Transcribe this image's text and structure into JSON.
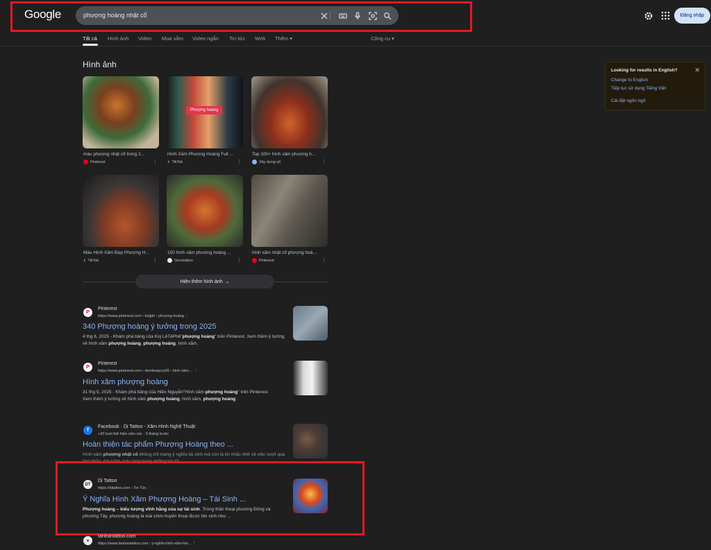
{
  "header": {
    "logo": "Google",
    "search_value": "phượng hoàng nhật cổ",
    "signin_label": "Đăng nhập"
  },
  "tabs": [
    {
      "label": "Tất cả"
    },
    {
      "label": "Hình ảnh"
    },
    {
      "label": "Video"
    },
    {
      "label": "Mua sắm"
    },
    {
      "label": "Video ngắn"
    },
    {
      "label": "Tin tức"
    },
    {
      "label": "Web"
    },
    {
      "label": "Thêm"
    }
  ],
  "tools_label": "Công cụ",
  "images": {
    "heading": "Hình ảnh",
    "badge": "Phượng hoàng",
    "more_label": "Hiện thêm hình ảnh",
    "items": [
      {
        "caption": "mẫu phượng nhật cổ trong 2...",
        "source": "Pinterest"
      },
      {
        "caption": "Hình Xăm Phượng Hoàng Full ...",
        "source": "TikTok"
      },
      {
        "caption": "Top 100+ hình xăm phượng h...",
        "source": "Xây dựng số"
      },
      {
        "caption": "Mẫu Hình Xăm Đẹp Phượng H...",
        "source": "TikTok"
      },
      {
        "caption": "150 hình xăm phượng hoàng ...",
        "source": "Genztattoo"
      },
      {
        "caption": "hình xăm nhật cổ phượng hoà...",
        "source": "Pinterest"
      }
    ]
  },
  "results": [
    {
      "site": "Pinterest",
      "url": "https://www.pinterest.com › kojtph › phượng-hoàng",
      "title": "340 Phượng hoàng ý tưởng trong 2025",
      "snippet_html": "4 thg 6, 2025 - Khám phá bảng của Koj LêTêPhê\"<b>phượng hoàng</b>\" trên Pinterest. Xem thêm ý tưởng về hình xăm <b>phượng hoàng</b>, <b>phượng hoàng</b>, hình xăm."
    },
    {
      "site": "Pinterest",
      "url": "https://www.pinterest.com › devilmaycry09 › hình-xăm-...",
      "title": "Hình xăm phượng hoàng",
      "snippet_html": "31 thg 5, 2025 - Khám phá bảng của Hiền Nguyễn\"Hình xăm <b>phượng hoàng</b>\" trên Pinterest. Xem thêm ý tưởng về hình xăm <b>phượng hoàng</b>, hình xăm, <b>phượng hoàng</b>."
    },
    {
      "site": "Facebook · Dị Tattoo - Xăm Hình Nghệ Thuật",
      "url": "+20 lượt thể hiện cảm xúc · 9 tháng trước",
      "title": "Hoàn thiện tác phẩm Phượng Hoàng theo ...",
      "snippet_html": "Hình xăm <b>phượng nhật cổ</b> không chỉ mang ý nghĩa tái sinh mà còn là lời nhắc nhở về việc vượt qua khó khăn, tìm kiếm ánh sáng trong những lúc tối ..."
    },
    {
      "site": "Dị Tattoo",
      "url": "https://ditattoo.com › Tin Tức",
      "title": "Ý Nghĩa Hình Xăm Phượng Hoàng – Tái Sinh ...",
      "snippet_html": "<b>Phượng hoàng – biểu tượng vĩnh hằng của sự tái sinh</b>. Trong thần thoại phương Đông và phương Tây, phượng hoàng là loài chim huyền thoại được tôn vinh như ..."
    },
    {
      "site": "tantrantattoo.com",
      "url": "https://www.tantrantattoo.com › ý-nghĩa-hình-xăm-hin..."
    }
  ],
  "lang_notice": {
    "title": "Looking for results in English?",
    "change": "Change to English",
    "keep": "Tiếp tục sử dụng Tiếng Việt",
    "settings": "Cài đặt ngôn ngữ"
  },
  "colors": {
    "background": "#1f1f1f",
    "link": "#8ab4f8",
    "highlight_box": "#e21a24"
  }
}
